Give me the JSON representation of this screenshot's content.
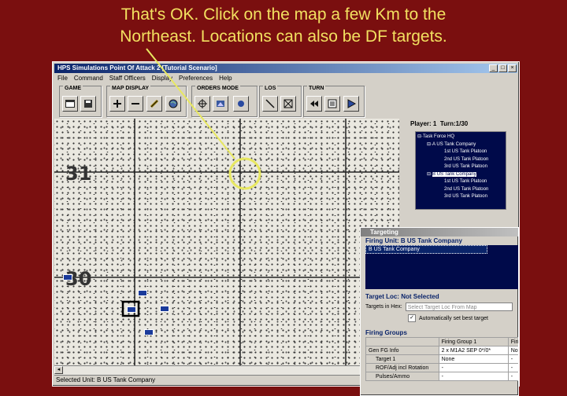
{
  "caption": {
    "line1": "That's OK.  Click on the map a few Km to the",
    "line2": "Northeast.  Locations can also be DF targets."
  },
  "window": {
    "title": "HPS Simulations Point Of Attack 2 [Tutorial Scenario]",
    "controls": [
      "_",
      "□",
      "×"
    ]
  },
  "menu": [
    "File",
    "Command",
    "Staff Officers",
    "Display",
    "Preferences",
    "Help"
  ],
  "toolbar": {
    "groups": [
      {
        "label": "GAME"
      },
      {
        "label": "MAP DISPLAY"
      },
      {
        "label": "ORDERS MODE"
      },
      {
        "label": "LOS"
      },
      {
        "label": "TURN"
      }
    ]
  },
  "map": {
    "grid_labels": {
      "row31": "31",
      "row30": "30"
    }
  },
  "side": {
    "player": "Player: 1",
    "turn": "Turn:1/30",
    "tree": [
      {
        "label": "Task Force HQ",
        "prefix": "⊟·"
      },
      {
        "label": "A  US Tank Company",
        "prefix": "⊟·"
      },
      {
        "label": "1st US Tank Platoon",
        "prefix": ""
      },
      {
        "label": "2nd US Tank Platoon",
        "prefix": ""
      },
      {
        "label": "3rd US Tank Platoon",
        "prefix": ""
      },
      {
        "label": "B  US Tank Company",
        "prefix": "⊟·"
      },
      {
        "label": "1st US Tank Platoon",
        "prefix": ""
      },
      {
        "label": "2nd US Tank Platoon",
        "prefix": ""
      },
      {
        "label": "3rd US Tank Platoon",
        "prefix": ""
      }
    ]
  },
  "targeting": {
    "title": "Targeting",
    "firing_unit_label": "Firing Unit: B  US Tank Company",
    "unit_list": [
      "B  US Tank Company"
    ],
    "target_loc_label": "Target Loc: Not Selected",
    "targets_in_hex_label": "Targets in Hex:",
    "targets_placeholder": "Select Target Loc From Map",
    "auto_best_label": "Automatically set best target",
    "auto_best_checked": "✓",
    "firing_groups_label": "Firing Groups",
    "table": {
      "headers": [
        "",
        "Firing Group 1",
        "Firi"
      ],
      "rows": [
        [
          "Gen FG Info",
          "2 x M1A2 SEP 0*/0*",
          "Nor"
        ],
        [
          "Target 1",
          "None",
          "-"
        ],
        [
          "ROF/Adj incl Rotation",
          "-",
          "-"
        ],
        [
          "Pulses/Ammo",
          "-",
          "-"
        ]
      ]
    }
  },
  "status": {
    "selected_unit": "Selected Unit: B  US Tank Company"
  },
  "colors": {
    "background": "#7a0f0f",
    "caption": "#f2e060",
    "annotation": "#e8e860",
    "unit_marker": "#1a3a9a"
  }
}
